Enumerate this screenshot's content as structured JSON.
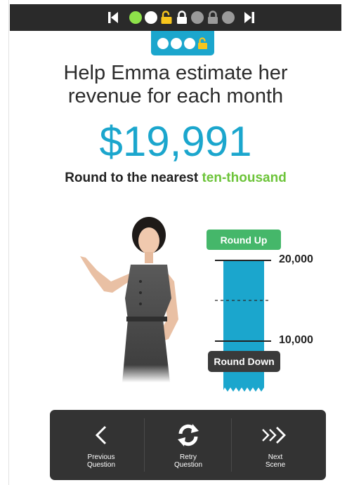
{
  "progress": {
    "first_icon": "skip-first-icon",
    "last_icon": "skip-last-icon",
    "steps": [
      {
        "state": "completed",
        "icon": "filled-circle"
      },
      {
        "state": "current",
        "icon": "filled-circle"
      },
      {
        "state": "unlocked",
        "icon": "unlocked-padlock-icon"
      },
      {
        "state": "locked",
        "icon": "locked-padlock-icon"
      },
      {
        "state": "locked",
        "icon": "filled-circle"
      },
      {
        "state": "locked",
        "icon": "locked-padlock-icon"
      },
      {
        "state": "locked",
        "icon": "filled-circle"
      }
    ]
  },
  "scene_tab": {
    "steps": [
      "circle",
      "circle",
      "circle",
      "unlocked-padlock"
    ]
  },
  "question": {
    "text": "Help Emma estimate her revenue for each month",
    "amount": "$19,991",
    "instruction_prefix": "Round to the nearest ",
    "instruction_place": "ten-thousand"
  },
  "numberline": {
    "upper_label": "20,000",
    "lower_label": "10,000",
    "round_up_label": "Round Up",
    "round_down_label": "Round Down"
  },
  "toolbar": {
    "previous_label": "Previous\nQuestion",
    "retry_label": "Retry\nQuestion",
    "next_label": "Next\nScene"
  },
  "colors": {
    "accent_blue": "#1ba6cd",
    "highlight_green": "#6dc43a",
    "round_up_green": "#45b76a",
    "progress_done": "#8ee24a",
    "lock_yellow": "#f7c51c",
    "dark_bar": "#2a2a2a",
    "toolbar": "#333333"
  }
}
